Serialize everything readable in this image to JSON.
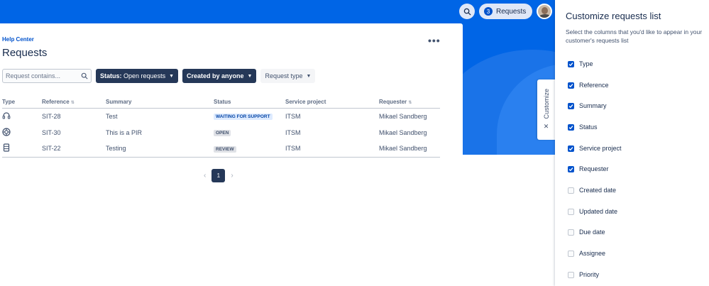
{
  "nav": {
    "requests_count": "3",
    "requests_label": "Requests"
  },
  "header": {
    "breadcrumb": "Help Center",
    "title": "Requests"
  },
  "filters": {
    "search_placeholder": "Request contains...",
    "status_prefix": "Status:",
    "status_value": "Open requests",
    "created_by": "Created by anyone",
    "request_type": "Request type"
  },
  "table": {
    "columns": [
      "Type",
      "Reference",
      "Summary",
      "Status",
      "Service project",
      "Requester"
    ],
    "rows": [
      {
        "type_icon": "headset-icon",
        "reference": "SIT-28",
        "summary": "Test",
        "status": "WAITING FOR SUPPORT",
        "status_color": "#deebff",
        "project": "ITSM",
        "requester": "Mikael Sandberg"
      },
      {
        "type_icon": "lifebuoy-icon",
        "reference": "SIT-30",
        "summary": "This is a PIR",
        "status": "OPEN",
        "status_color": "#dfe1e6",
        "project": "ITSM",
        "requester": "Mikael Sandberg"
      },
      {
        "type_icon": "server-icon",
        "reference": "SIT-22",
        "summary": "Testing",
        "status": "REVIEW",
        "status_color": "#dfe1e6",
        "project": "ITSM",
        "requester": "Mikael Sandberg"
      }
    ]
  },
  "pagination": {
    "current": "1"
  },
  "customize_tab": {
    "label": "Customize"
  },
  "panel": {
    "title": "Customize requests list",
    "description": "Select the columns that you'd like to appear in your customer's requests list",
    "options": [
      {
        "label": "Type",
        "checked": true
      },
      {
        "label": "Reference",
        "checked": true
      },
      {
        "label": "Summary",
        "checked": true
      },
      {
        "label": "Status",
        "checked": true
      },
      {
        "label": "Service project",
        "checked": true
      },
      {
        "label": "Requester",
        "checked": true
      },
      {
        "label": "Created date",
        "checked": false
      },
      {
        "label": "Updated date",
        "checked": false
      },
      {
        "label": "Due date",
        "checked": false
      },
      {
        "label": "Assignee",
        "checked": false
      },
      {
        "label": "Priority",
        "checked": false
      }
    ]
  },
  "colors": {
    "brand_blue": "#0065e6",
    "dark_pill": "#253858",
    "checkbox_on": "#0052cc"
  }
}
